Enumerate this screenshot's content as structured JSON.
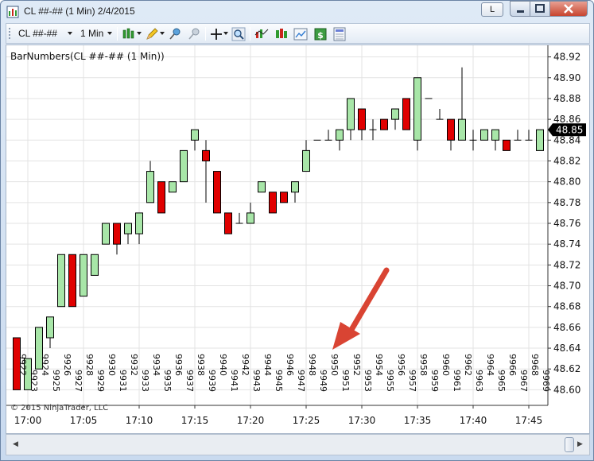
{
  "window": {
    "title": "CL ##-## (1 Min)  2/4/2015",
    "link_label": "L",
    "icons": [
      "ninjatrader-chart-icon",
      "minimize-icon",
      "maximize-icon",
      "close-icon"
    ]
  },
  "toolbar": {
    "instrument": "CL ##-##",
    "period": "1 Min",
    "icons": [
      "bar-style-icon",
      "drawing-tool-icon",
      "pin-icon",
      "unpin-icon",
      "crosshair-icon",
      "zoom-icon",
      "indicators-icon",
      "strategies-icon",
      "chart-trader-icon",
      "dollar-icon",
      "data-box-icon"
    ]
  },
  "colors": {
    "up": "#a8e6a8",
    "down": "#e00000",
    "grid": "#e3e3e3",
    "arrow": "#d94433",
    "price_marker": "#000000"
  },
  "chart": {
    "indicator_label": "BarNumbers(CL ##-## (1 Min))",
    "copyright": "© 2015 NinjaTrader, LLC",
    "current_price_label": "48.85"
  },
  "chart_data": {
    "type": "candlestick",
    "ylim": [
      48.585,
      48.935
    ],
    "y_ticks": [
      "48.60",
      "48.62",
      "48.64",
      "48.66",
      "48.68",
      "48.70",
      "48.72",
      "48.74",
      "48.76",
      "48.78",
      "48.80",
      "48.82",
      "48.84",
      "48.86",
      "48.88",
      "48.90",
      "48.92"
    ],
    "x_ticks": [
      "17:00",
      "17:05",
      "17:10",
      "17:15",
      "17:20",
      "17:25",
      "17:30",
      "17:35",
      "17:40",
      "17:45"
    ],
    "current_price": 48.85,
    "candles": [
      {
        "n": "9922",
        "o": 48.65,
        "h": 48.65,
        "l": 48.6,
        "c": 48.6
      },
      {
        "n": "9923",
        "o": 48.6,
        "h": 48.63,
        "l": 48.6,
        "c": 48.63
      },
      {
        "n": "9924",
        "o": 48.62,
        "h": 48.66,
        "l": 48.62,
        "c": 48.66
      },
      {
        "n": "9925",
        "o": 48.65,
        "h": 48.67,
        "l": 48.64,
        "c": 48.67
      },
      {
        "n": "9926",
        "o": 48.68,
        "h": 48.73,
        "l": 48.68,
        "c": 48.73
      },
      {
        "n": "9927",
        "o": 48.73,
        "h": 48.73,
        "l": 48.68,
        "c": 48.68
      },
      {
        "n": "9928",
        "o": 48.69,
        "h": 48.73,
        "l": 48.69,
        "c": 48.73
      },
      {
        "n": "9929",
        "o": 48.71,
        "h": 48.73,
        "l": 48.71,
        "c": 48.73
      },
      {
        "n": "9930",
        "o": 48.74,
        "h": 48.76,
        "l": 48.74,
        "c": 48.76
      },
      {
        "n": "9931",
        "o": 48.76,
        "h": 48.76,
        "l": 48.73,
        "c": 48.74
      },
      {
        "n": "9932",
        "o": 48.75,
        "h": 48.76,
        "l": 48.74,
        "c": 48.76
      },
      {
        "n": "9933",
        "o": 48.75,
        "h": 48.77,
        "l": 48.74,
        "c": 48.77
      },
      {
        "n": "9934",
        "o": 48.78,
        "h": 48.82,
        "l": 48.78,
        "c": 48.81
      },
      {
        "n": "9935",
        "o": 48.8,
        "h": 48.8,
        "l": 48.77,
        "c": 48.77
      },
      {
        "n": "9936",
        "o": 48.79,
        "h": 48.8,
        "l": 48.79,
        "c": 48.8
      },
      {
        "n": "9937",
        "o": 48.8,
        "h": 48.83,
        "l": 48.8,
        "c": 48.83
      },
      {
        "n": "9938",
        "o": 48.84,
        "h": 48.85,
        "l": 48.83,
        "c": 48.85
      },
      {
        "n": "9939",
        "o": 48.83,
        "h": 48.84,
        "l": 48.78,
        "c": 48.82
      },
      {
        "n": "9940",
        "o": 48.81,
        "h": 48.81,
        "l": 48.77,
        "c": 48.77
      },
      {
        "n": "9941",
        "o": 48.77,
        "h": 48.77,
        "l": 48.75,
        "c": 48.75
      },
      {
        "n": "9942",
        "o": 48.76,
        "h": 48.77,
        "l": 48.76,
        "c": 48.76
      },
      {
        "n": "9943",
        "o": 48.76,
        "h": 48.78,
        "l": 48.76,
        "c": 48.77
      },
      {
        "n": "9944",
        "o": 48.79,
        "h": 48.8,
        "l": 48.79,
        "c": 48.8
      },
      {
        "n": "9945",
        "o": 48.79,
        "h": 48.79,
        "l": 48.77,
        "c": 48.77
      },
      {
        "n": "9946",
        "o": 48.79,
        "h": 48.79,
        "l": 48.78,
        "c": 48.78
      },
      {
        "n": "9947",
        "o": 48.79,
        "h": 48.8,
        "l": 48.78,
        "c": 48.8
      },
      {
        "n": "9948",
        "o": 48.81,
        "h": 48.84,
        "l": 48.81,
        "c": 48.83
      },
      {
        "n": "9949",
        "o": 48.84,
        "h": 48.84,
        "l": 48.84,
        "c": 48.84
      },
      {
        "n": "9950",
        "o": 48.84,
        "h": 48.85,
        "l": 48.84,
        "c": 48.84
      },
      {
        "n": "9951",
        "o": 48.84,
        "h": 48.85,
        "l": 48.83,
        "c": 48.85
      },
      {
        "n": "9952",
        "o": 48.85,
        "h": 48.88,
        "l": 48.84,
        "c": 48.88
      },
      {
        "n": "9953",
        "o": 48.87,
        "h": 48.87,
        "l": 48.84,
        "c": 48.85
      },
      {
        "n": "9954",
        "o": 48.85,
        "h": 48.86,
        "l": 48.84,
        "c": 48.85
      },
      {
        "n": "9955",
        "o": 48.86,
        "h": 48.86,
        "l": 48.85,
        "c": 48.85
      },
      {
        "n": "9956",
        "o": 48.86,
        "h": 48.87,
        "l": 48.85,
        "c": 48.87
      },
      {
        "n": "9957",
        "o": 48.88,
        "h": 48.88,
        "l": 48.85,
        "c": 48.85
      },
      {
        "n": "9958",
        "o": 48.84,
        "h": 48.9,
        "l": 48.83,
        "c": 48.9
      },
      {
        "n": "9959",
        "o": 48.88,
        "h": 48.88,
        "l": 48.88,
        "c": 48.88
      },
      {
        "n": "9960",
        "o": 48.86,
        "h": 48.87,
        "l": 48.86,
        "c": 48.86
      },
      {
        "n": "9961",
        "o": 48.86,
        "h": 48.86,
        "l": 48.83,
        "c": 48.84
      },
      {
        "n": "9962",
        "o": 48.84,
        "h": 48.91,
        "l": 48.84,
        "c": 48.86
      },
      {
        "n": "9963",
        "o": 48.84,
        "h": 48.85,
        "l": 48.83,
        "c": 48.84
      },
      {
        "n": "9964",
        "o": 48.84,
        "h": 48.85,
        "l": 48.84,
        "c": 48.85
      },
      {
        "n": "9965",
        "o": 48.84,
        "h": 48.85,
        "l": 48.83,
        "c": 48.85
      },
      {
        "n": "9966",
        "o": 48.84,
        "h": 48.84,
        "l": 48.83,
        "c": 48.83
      },
      {
        "n": "9967",
        "o": 48.84,
        "h": 48.85,
        "l": 48.84,
        "c": 48.84
      },
      {
        "n": "9968",
        "o": 48.84,
        "h": 48.85,
        "l": 48.84,
        "c": 48.84
      },
      {
        "n": "9969",
        "o": 48.83,
        "h": 48.85,
        "l": 48.83,
        "c": 48.85
      }
    ]
  }
}
